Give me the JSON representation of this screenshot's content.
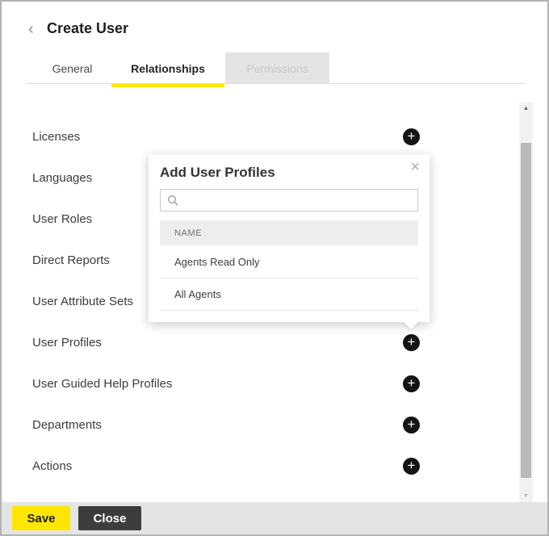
{
  "window": {
    "title": "Create User"
  },
  "icons": {
    "back": "‹",
    "close": "×",
    "add": "+",
    "scroll_up": "▲",
    "scroll_down": "▼"
  },
  "tabs": [
    {
      "label": "General",
      "state": "normal"
    },
    {
      "label": "Relationships",
      "state": "active"
    },
    {
      "label": "Permissions",
      "state": "disabled"
    }
  ],
  "sections": [
    {
      "label": "Licenses"
    },
    {
      "label": "Languages"
    },
    {
      "label": "User Roles"
    },
    {
      "label": "Direct Reports"
    },
    {
      "label": "User Attribute Sets"
    },
    {
      "label": "User Profiles"
    },
    {
      "label": "User Guided Help Profiles"
    },
    {
      "label": "Departments"
    },
    {
      "label": "Actions"
    }
  ],
  "popup": {
    "title": "Add User Profiles",
    "search": {
      "value": "",
      "placeholder": ""
    },
    "table": {
      "header": "NAME",
      "rows": [
        "Agents Read Only",
        "All Agents"
      ]
    }
  },
  "footer": {
    "save": "Save",
    "close": "Close"
  },
  "colors": {
    "accent_yellow": "#ffe600",
    "tab_disabled_bg": "#e4e4e4",
    "add_icon_bg": "#141414",
    "close_button_bg": "#3d3d3d",
    "footer_bg": "#e4e4e4"
  }
}
